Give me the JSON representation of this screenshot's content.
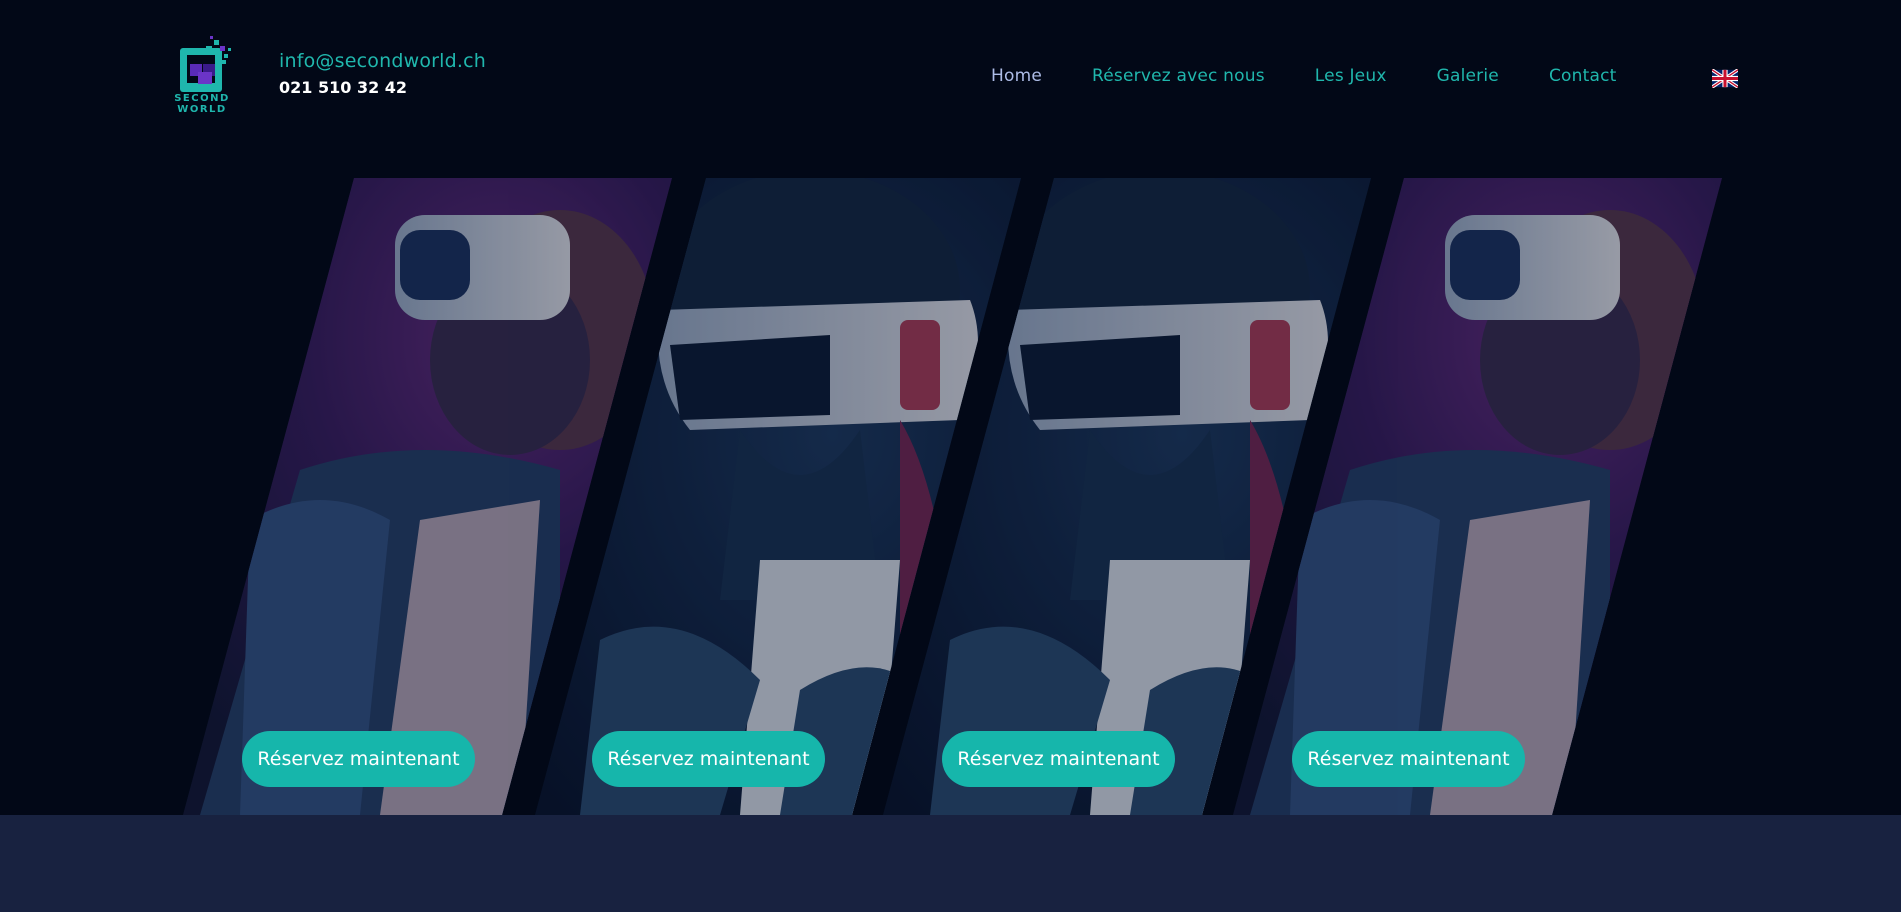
{
  "brand": {
    "logo_text": "SECOND WORLD"
  },
  "contact": {
    "email": "info@secondworld.ch",
    "phone": "021 510 32 42"
  },
  "nav": {
    "items": [
      {
        "label": "Home",
        "active": true
      },
      {
        "label": "Réservez avec nous",
        "active": false
      },
      {
        "label": "Les Jeux",
        "active": false
      },
      {
        "label": "Galerie",
        "active": false
      },
      {
        "label": "Contact",
        "active": false
      }
    ],
    "language_icon": "uk-flag-icon"
  },
  "hero": {
    "cta_label": "Réservez maintenant",
    "panels": [
      {
        "image": "vr-headset-person-denim-jacket"
      },
      {
        "image": "vr-headset-person-hands-out"
      },
      {
        "image": "vr-headset-person-hands-out"
      },
      {
        "image": "vr-headset-person-denim-jacket"
      }
    ]
  },
  "colors": {
    "background": "#020817",
    "accent": "#16b6ab",
    "nav_active": "#aebde8",
    "footer_band": "#182240"
  }
}
